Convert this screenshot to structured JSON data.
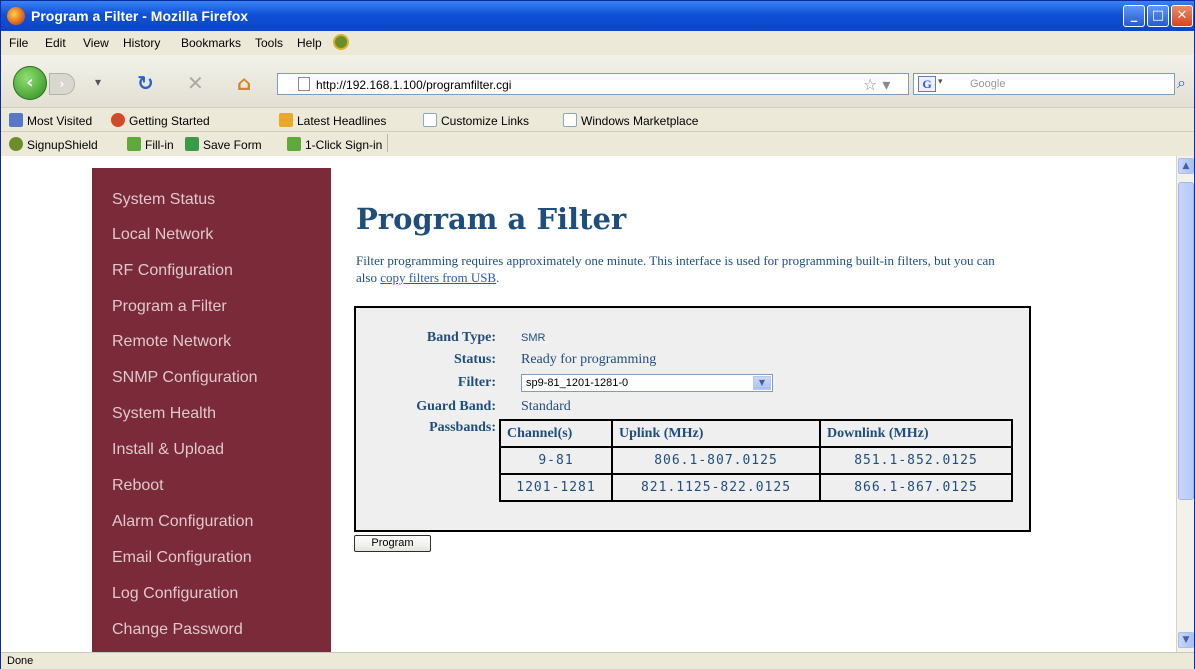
{
  "window": {
    "title": "Program a Filter - Mozilla Firefox"
  },
  "menu": [
    "File",
    "Edit",
    "View",
    "History",
    "Bookmarks",
    "Tools",
    "Help"
  ],
  "nav": {
    "url": "http://192.168.1.100/programfilter.cgi",
    "search_placeholder": "Google"
  },
  "bookmarks": [
    "Most Visited",
    "Getting Started",
    "Latest Headlines",
    "Customize Links",
    "Windows Marketplace"
  ],
  "toolbar2": [
    "SignupShield",
    "Fill-in",
    "Save Form",
    "1-Click Sign-in"
  ],
  "sidebar": {
    "items": [
      {
        "label": "System Status"
      },
      {
        "label": "Local Network"
      },
      {
        "label": "RF Configuration"
      },
      {
        "label": "Program a Filter"
      },
      {
        "label": "Remote Network"
      },
      {
        "label": "SNMP Configuration"
      },
      {
        "label": "System Health"
      },
      {
        "label": "Install & Upload"
      },
      {
        "label": "Reboot"
      },
      {
        "label": "Alarm Configuration"
      },
      {
        "label": "Email Configuration"
      },
      {
        "label": "Log Configuration"
      },
      {
        "label": "Change Password"
      }
    ]
  },
  "page": {
    "title": "Program a Filter",
    "intro_text": "Filter programming requires approximately one minute. This interface is used for programming built-in filters, but you can also ",
    "intro_link": "copy filters from USB",
    "intro_end": "."
  },
  "form": {
    "band_type_label": "Band Type:",
    "band_type": "SMR",
    "status_label": "Status:",
    "status": "Ready for programming",
    "filter_label": "Filter:",
    "filter_selected": "sp9-81_1201-1281-0",
    "guard_band_label": "Guard Band:",
    "guard_band": "Standard",
    "passbands_label": "Passbands:",
    "columns": [
      "Channel(s)",
      "Uplink (MHz)",
      "Downlink (MHz)"
    ],
    "rows": [
      [
        "9-81",
        "806.1-807.0125",
        "851.1-852.0125"
      ],
      [
        "1201-1281",
        "821.1125-822.0125",
        "866.1-867.0125"
      ]
    ],
    "program_button": "Program"
  },
  "status_bar": "Done",
  "colors": {
    "sidebar_bg": "#7b2a3a",
    "heading": "#1f4e7d",
    "titlebar": "#0b45c8"
  }
}
